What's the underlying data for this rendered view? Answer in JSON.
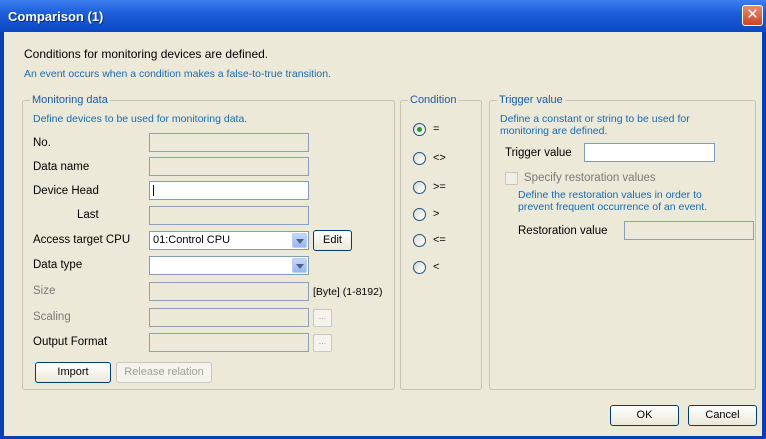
{
  "window": {
    "title": "Comparison (1)",
    "close_glyph": "✕"
  },
  "description": {
    "line1": "Conditions for monitoring devices are defined.",
    "line2": "An event occurs when a condition makes a false-to-true transition."
  },
  "monitoring": {
    "title": "Monitoring data",
    "hint": "Define devices to be used for monitoring data.",
    "labels": {
      "no": "No.",
      "data_name": "Data name",
      "device_head": "Device Head",
      "last": "Last",
      "access_cpu": "Access target CPU",
      "data_type": "Data type",
      "size": "Size",
      "scaling": "Scaling",
      "output_format": "Output Format"
    },
    "values": {
      "no": "",
      "data_name": "",
      "device_head": "",
      "last": "",
      "access_cpu": "01:Control CPU",
      "data_type": "",
      "size": ""
    },
    "size_range": "[Byte] (1-8192)",
    "edit_label": "Edit",
    "ellipsis": "...",
    "import_label": "Import",
    "release_label": "Release relation"
  },
  "condition": {
    "title": "Condition",
    "options": [
      "=",
      "<>",
      ">=",
      ">",
      "<=",
      "<"
    ],
    "selected": "="
  },
  "trigger": {
    "title": "Trigger value",
    "hint_line1": "Define a constant or string to be used for",
    "hint_line2": "monitoring are defined.",
    "trigger_label": "Trigger value",
    "trigger_value": "",
    "specify_label": "Specify restoration values",
    "specify_checked": false,
    "restore_hint_line1": "Define the restoration values in order to",
    "restore_hint_line2": "prevent frequent occurrence of an event.",
    "restoration_label": "Restoration value",
    "restoration_value": ""
  },
  "footer": {
    "ok_label": "OK",
    "cancel_label": "Cancel"
  },
  "colors": {
    "titlebar": "#1d5fd9",
    "dialog_bg": "#ece9d8",
    "hint_text": "#1a6ab0",
    "radio_selected": "#21a121"
  }
}
